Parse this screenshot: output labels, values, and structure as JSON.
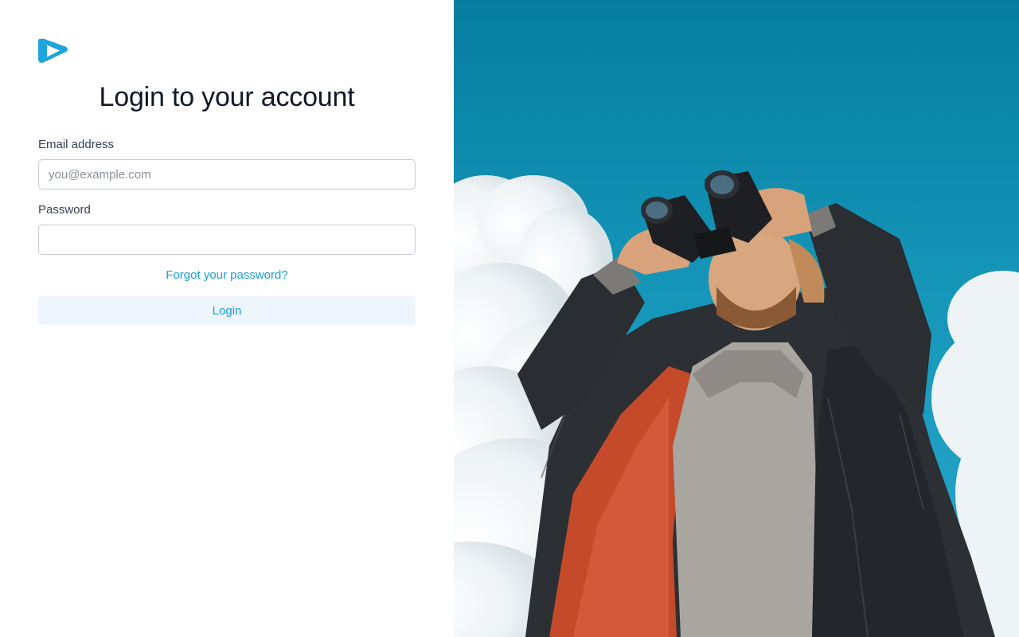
{
  "brand": {
    "logo_icon": "play-triangle-logo-icon",
    "accent_color": "#1a9fd8"
  },
  "form": {
    "title": "Login to your account",
    "email": {
      "label": "Email address",
      "placeholder": "you@example.com",
      "value": ""
    },
    "password": {
      "label": "Password",
      "placeholder": "",
      "value": ""
    },
    "forgot_link": "Forgot your password?",
    "submit_label": "Login"
  },
  "hero": {
    "image_subject": "hero-photo-binoculars"
  }
}
